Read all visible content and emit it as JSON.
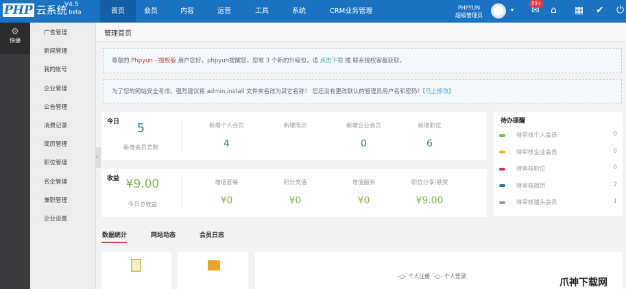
{
  "header": {
    "logo": "PHP",
    "logo_text": "云系统",
    "version": "V4.5",
    "beta": "beta",
    "nav": [
      "首页",
      "会员",
      "内容",
      "运营",
      "工具",
      "系统",
      "CRM业务管理"
    ],
    "user_name": "PHPYUN",
    "user_role": "超级管理员",
    "badge": "99+"
  },
  "sidebar": {
    "quick": "快捷",
    "items": [
      "广告管理",
      "新闻管理",
      "我的帐号",
      "企业管理",
      "公告管理",
      "消费记录",
      "简历管理",
      "职位管理",
      "名企管理",
      "兼职管理",
      "企业设置"
    ]
  },
  "page_title": "管理首页",
  "notice1": {
    "a": "尊敬的 ",
    "brand": "Phpyun - 授权版",
    "b": " 用户您好，phpyun提醒您，您有 3 个新的升级包，请 ",
    "link": "点击下载",
    "c": " 或 联系授权客服获取。"
  },
  "notice2": {
    "a": "为了您的网站安全考虑，强烈建议将 admin,install 文件夹名改为其它名称！ 您还没有更改默认的管理员用户名和密码!",
    "link": "【马上修改】"
  },
  "today": {
    "title": "今日",
    "total": "5",
    "total_label": "新增会员总数",
    "stats": [
      {
        "label": "新增个人会员",
        "value": "4"
      },
      {
        "label": "新增简历",
        "value": ""
      },
      {
        "label": "新增企业会员",
        "value": "0"
      },
      {
        "label": "新增职位",
        "value": "6"
      }
    ]
  },
  "income": {
    "title": "收益",
    "total": "¥9.00",
    "total_label": "今日总收益",
    "stats": [
      {
        "label": "增值套餐",
        "value": "¥0"
      },
      {
        "label": "积分充值",
        "value": "¥0"
      },
      {
        "label": "增值服务",
        "value": "¥0"
      },
      {
        "label": "职位分享/悬赏",
        "value": "¥9.00"
      }
    ]
  },
  "todo": {
    "title": "待办提醒",
    "items": [
      {
        "label": "待审核个人会员",
        "count": "0",
        "color": "#7cb84a"
      },
      {
        "label": "待审核企业会员",
        "count": "0",
        "color": "#e6b030"
      },
      {
        "label": "待审核职位",
        "count": "0",
        "color": "#c0325a"
      },
      {
        "label": "待审核简历",
        "count": "2",
        "color": "#2e74b5"
      },
      {
        "label": "待审核猎头会员",
        "count": "1",
        "color": "#999999"
      }
    ]
  },
  "tabs": [
    "数据统计",
    "网站动态",
    "会员日志"
  ],
  "legend": [
    "个人注册",
    "个人登录"
  ],
  "watermark": "爪神下载网"
}
